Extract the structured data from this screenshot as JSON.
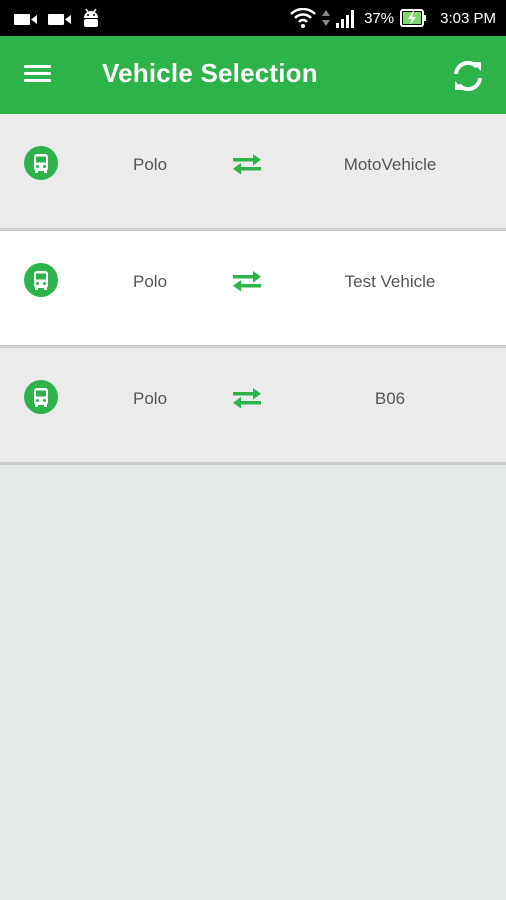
{
  "status_bar": {
    "battery_percent": "37%",
    "time": "3:03 PM"
  },
  "app_bar": {
    "title": "Vehicle Selection",
    "menu_icon": "hamburger-menu-icon",
    "refresh_icon": "refresh-icon"
  },
  "vehicles": [
    {
      "model": "Polo",
      "name": "MotoVehicle",
      "bg": "#ebebeb"
    },
    {
      "model": "Polo",
      "name": "Test Vehicle",
      "bg": "#ffffff"
    },
    {
      "model": "Polo",
      "name": "B06",
      "bg": "#ebebeb"
    }
  ],
  "colors": {
    "accent": "#2db34a",
    "background": "#e4e9e5",
    "text": "#555555"
  }
}
